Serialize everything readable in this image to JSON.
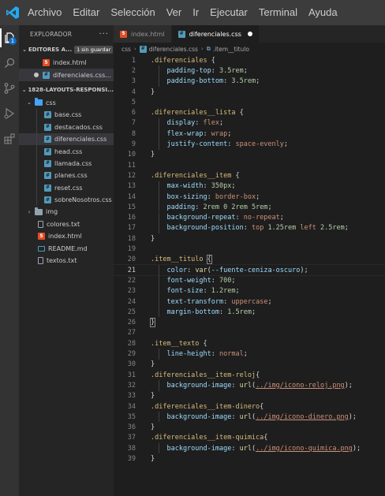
{
  "menubar": {
    "items": [
      "Archivo",
      "Editar",
      "Selección",
      "Ver",
      "Ir",
      "Ejecutar",
      "Terminal",
      "Ayuda"
    ]
  },
  "activity": {
    "explorer_badge": "1"
  },
  "sidebar": {
    "title": "EXPLORADOR",
    "more": "···",
    "open_editors": {
      "title": "EDITORES A...",
      "badge": "1 sin guardar",
      "files": [
        "index.html",
        "diferenciales.css..."
      ]
    },
    "project": {
      "title": "1828-LAYOUTS-RESPONSI...",
      "css_folder": "css",
      "css_files": [
        "base.css",
        "destacados.css",
        "diferenciales.css",
        "head.css",
        "llamada.css",
        "planes.css",
        "reset.css",
        "sobreNosotros.css"
      ],
      "img_folder": "img",
      "root_files": [
        {
          "name": "colores.txt",
          "type": "txt"
        },
        {
          "name": "index.html",
          "type": "html"
        },
        {
          "name": "README.md",
          "type": "md"
        },
        {
          "name": "textos.txt",
          "type": "txt"
        }
      ]
    }
  },
  "tabs": [
    {
      "label": "index.html",
      "type": "html",
      "active": false
    },
    {
      "label": "diferenciales.css",
      "type": "css",
      "active": true
    }
  ],
  "breadcrumb": {
    "folder": "css",
    "file": "diferenciales.css",
    "symbol": ".item__titulo"
  },
  "editor": {
    "current_line": 21,
    "lines": [
      {
        "n": "1",
        "parts": [
          {
            "c": "t-sel",
            "t": ".diferenciales"
          },
          {
            "c": "t-punc",
            "t": " {"
          }
        ]
      },
      {
        "n": "2",
        "parts": [
          {
            "c": "t-prop",
            "t": "    padding-top"
          },
          {
            "c": "t-punc",
            "t": ": "
          },
          {
            "c": "t-num",
            "t": "3.5rem"
          },
          {
            "c": "t-punc",
            "t": ";"
          }
        ]
      },
      {
        "n": "3",
        "parts": [
          {
            "c": "t-prop",
            "t": "    padding-bottom"
          },
          {
            "c": "t-punc",
            "t": ": "
          },
          {
            "c": "t-num",
            "t": "3.5rem"
          },
          {
            "c": "t-punc",
            "t": ";"
          }
        ]
      },
      {
        "n": "4",
        "parts": [
          {
            "c": "t-punc",
            "t": "}"
          }
        ]
      },
      {
        "n": "5",
        "parts": []
      },
      {
        "n": "6",
        "parts": [
          {
            "c": "t-sel",
            "t": ".diferenciales__lista"
          },
          {
            "c": "t-punc",
            "t": " {"
          }
        ]
      },
      {
        "n": "7",
        "parts": [
          {
            "c": "t-prop",
            "t": "    display"
          },
          {
            "c": "t-punc",
            "t": ": "
          },
          {
            "c": "t-val",
            "t": "flex"
          },
          {
            "c": "t-punc",
            "t": ";"
          }
        ]
      },
      {
        "n": "8",
        "parts": [
          {
            "c": "t-prop",
            "t": "    flex-wrap"
          },
          {
            "c": "t-punc",
            "t": ": "
          },
          {
            "c": "t-val",
            "t": "wrap"
          },
          {
            "c": "t-punc",
            "t": ";"
          }
        ]
      },
      {
        "n": "9",
        "parts": [
          {
            "c": "t-prop",
            "t": "    justify-content"
          },
          {
            "c": "t-punc",
            "t": ": "
          },
          {
            "c": "t-val",
            "t": "space-evenly"
          },
          {
            "c": "t-punc",
            "t": ";"
          }
        ]
      },
      {
        "n": "10",
        "parts": [
          {
            "c": "t-punc",
            "t": "}"
          }
        ]
      },
      {
        "n": "11",
        "parts": []
      },
      {
        "n": "12",
        "parts": [
          {
            "c": "t-sel",
            "t": ".diferenciales__item"
          },
          {
            "c": "t-punc",
            "t": " {"
          }
        ]
      },
      {
        "n": "13",
        "parts": [
          {
            "c": "t-prop",
            "t": "    max-width"
          },
          {
            "c": "t-punc",
            "t": ": "
          },
          {
            "c": "t-num",
            "t": "350px"
          },
          {
            "c": "t-punc",
            "t": ";"
          }
        ]
      },
      {
        "n": "14",
        "parts": [
          {
            "c": "t-prop",
            "t": "    box-sizing"
          },
          {
            "c": "t-punc",
            "t": ": "
          },
          {
            "c": "t-val",
            "t": "border-box"
          },
          {
            "c": "t-punc",
            "t": ";"
          }
        ]
      },
      {
        "n": "15",
        "parts": [
          {
            "c": "t-prop",
            "t": "    padding"
          },
          {
            "c": "t-punc",
            "t": ": "
          },
          {
            "c": "t-num",
            "t": "2rem 0 2rem 5rem"
          },
          {
            "c": "t-punc",
            "t": ";"
          }
        ]
      },
      {
        "n": "16",
        "parts": [
          {
            "c": "t-prop",
            "t": "    background-repeat"
          },
          {
            "c": "t-punc",
            "t": ": "
          },
          {
            "c": "t-val",
            "t": "no-repeat"
          },
          {
            "c": "t-punc",
            "t": ";"
          }
        ]
      },
      {
        "n": "17",
        "parts": [
          {
            "c": "t-prop",
            "t": "    background-position"
          },
          {
            "c": "t-punc",
            "t": ": "
          },
          {
            "c": "t-val",
            "t": "top "
          },
          {
            "c": "t-num",
            "t": "1.25rem"
          },
          {
            "c": "t-val",
            "t": " left "
          },
          {
            "c": "t-num",
            "t": "2.5rem"
          },
          {
            "c": "t-punc",
            "t": ";"
          }
        ]
      },
      {
        "n": "18",
        "parts": [
          {
            "c": "t-punc",
            "t": "}"
          }
        ]
      },
      {
        "n": "19",
        "parts": []
      },
      {
        "n": "20",
        "parts": [
          {
            "c": "t-sel",
            "t": ".item__titulo"
          },
          {
            "c": "t-punc",
            "t": " "
          },
          {
            "c": "t-punc t-bracket",
            "t": "{"
          }
        ]
      },
      {
        "n": "21",
        "parts": [
          {
            "c": "t-prop",
            "t": "    color"
          },
          {
            "c": "t-punc",
            "t": ": "
          },
          {
            "c": "t-fn",
            "t": "var"
          },
          {
            "c": "t-punc",
            "t": "("
          },
          {
            "c": "t-prop",
            "t": "--fuente-ceniza-oscuro"
          },
          {
            "c": "t-punc",
            "t": ");"
          }
        ]
      },
      {
        "n": "22",
        "parts": [
          {
            "c": "t-prop",
            "t": "    font-weight"
          },
          {
            "c": "t-punc",
            "t": ": "
          },
          {
            "c": "t-num",
            "t": "700"
          },
          {
            "c": "t-punc",
            "t": ";"
          }
        ]
      },
      {
        "n": "23",
        "parts": [
          {
            "c": "t-prop",
            "t": "    font-size"
          },
          {
            "c": "t-punc",
            "t": ": "
          },
          {
            "c": "t-num",
            "t": "1.2rem"
          },
          {
            "c": "t-punc",
            "t": ";"
          }
        ]
      },
      {
        "n": "24",
        "parts": [
          {
            "c": "t-prop",
            "t": "    text-transform"
          },
          {
            "c": "t-punc",
            "t": ": "
          },
          {
            "c": "t-val",
            "t": "uppercase"
          },
          {
            "c": "t-punc",
            "t": ";"
          }
        ]
      },
      {
        "n": "25",
        "parts": [
          {
            "c": "t-prop",
            "t": "    margin-bottom"
          },
          {
            "c": "t-punc",
            "t": ": "
          },
          {
            "c": "t-num",
            "t": "1.5rem"
          },
          {
            "c": "t-punc",
            "t": ";"
          }
        ]
      },
      {
        "n": "26",
        "parts": [
          {
            "c": "t-punc t-bracket",
            "t": "}"
          }
        ]
      },
      {
        "n": "27",
        "parts": []
      },
      {
        "n": "28",
        "parts": [
          {
            "c": "t-sel",
            "t": ".item__texto"
          },
          {
            "c": "t-punc",
            "t": " {"
          }
        ]
      },
      {
        "n": "29",
        "parts": [
          {
            "c": "t-prop",
            "t": "    line-height"
          },
          {
            "c": "t-punc",
            "t": ": "
          },
          {
            "c": "t-val",
            "t": "normal"
          },
          {
            "c": "t-punc",
            "t": ";"
          }
        ]
      },
      {
        "n": "30",
        "parts": [
          {
            "c": "t-punc",
            "t": "}"
          }
        ]
      },
      {
        "n": "31",
        "parts": [
          {
            "c": "t-sel",
            "t": ".diferenciales__item-reloj"
          },
          {
            "c": "t-punc",
            "t": "{"
          }
        ]
      },
      {
        "n": "32",
        "parts": [
          {
            "c": "t-prop",
            "t": "    background-image"
          },
          {
            "c": "t-punc",
            "t": ": "
          },
          {
            "c": "t-fn",
            "t": "url"
          },
          {
            "c": "t-punc",
            "t": "("
          },
          {
            "c": "t-link",
            "t": "../img/icono-reloj.png"
          },
          {
            "c": "t-punc",
            "t": ");"
          }
        ]
      },
      {
        "n": "33",
        "parts": [
          {
            "c": "t-punc",
            "t": "}"
          }
        ]
      },
      {
        "n": "34",
        "parts": [
          {
            "c": "t-sel",
            "t": ".diferenciales__item-dinero"
          },
          {
            "c": "t-punc",
            "t": "{"
          }
        ]
      },
      {
        "n": "35",
        "parts": [
          {
            "c": "t-prop",
            "t": "    background-image"
          },
          {
            "c": "t-punc",
            "t": ": "
          },
          {
            "c": "t-fn",
            "t": "url"
          },
          {
            "c": "t-punc",
            "t": "("
          },
          {
            "c": "t-link",
            "t": "../img/icono-dinero.png"
          },
          {
            "c": "t-punc",
            "t": ");"
          }
        ]
      },
      {
        "n": "36",
        "parts": [
          {
            "c": "t-punc",
            "t": "}"
          }
        ]
      },
      {
        "n": "37",
        "parts": [
          {
            "c": "t-sel",
            "t": ".diferenciales__item-quimica"
          },
          {
            "c": "t-punc",
            "t": "{"
          }
        ]
      },
      {
        "n": "38",
        "parts": [
          {
            "c": "t-prop",
            "t": "    background-image"
          },
          {
            "c": "t-punc",
            "t": ": "
          },
          {
            "c": "t-fn",
            "t": "url"
          },
          {
            "c": "t-punc",
            "t": "("
          },
          {
            "c": "t-link",
            "t": "../img/icono-quimica.png"
          },
          {
            "c": "t-punc",
            "t": ");"
          }
        ]
      },
      {
        "n": "39",
        "parts": [
          {
            "c": "t-punc",
            "t": "}"
          }
        ]
      }
    ]
  },
  "colors": {
    "accent": "#0e70c0",
    "logo": "#23a9f2"
  }
}
